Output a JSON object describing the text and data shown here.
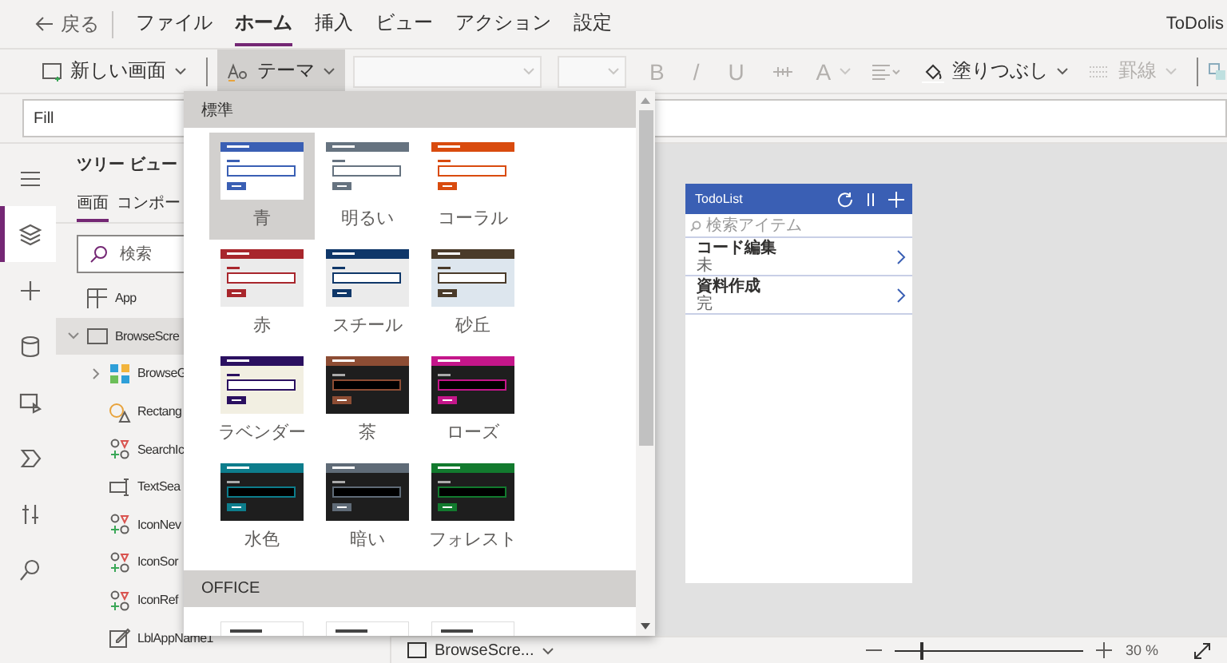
{
  "menu": {
    "back": "戻る",
    "tabs": [
      {
        "label": "ファイル",
        "selected": false
      },
      {
        "label": "ホーム",
        "selected": true
      },
      {
        "label": "挿入",
        "selected": false
      },
      {
        "label": "ビュー",
        "selected": false
      },
      {
        "label": "アクション",
        "selected": false
      },
      {
        "label": "設定",
        "selected": false
      }
    ],
    "app_name": "ToDolis"
  },
  "toolbar": {
    "new_screen": "新しい画面",
    "theme": {
      "label": "テーマ",
      "expanded": true
    },
    "format": [
      {
        "label": "B",
        "disabled": true
      },
      {
        "label": "/",
        "disabled": true
      },
      {
        "label": "U",
        "disabled": true
      },
      {
        "label": "A",
        "disabled": true
      }
    ],
    "fill": {
      "label": "塗りつぶし",
      "disabled": false
    },
    "border": {
      "label": "罫線",
      "disabled": true
    }
  },
  "formula": {
    "property": "Fill"
  },
  "rail": [
    {
      "kind": "menu",
      "selected": false
    },
    {
      "kind": "layers",
      "selected": true
    },
    {
      "kind": "insert",
      "selected": false
    },
    {
      "kind": "data",
      "selected": false
    },
    {
      "kind": "media",
      "selected": false
    },
    {
      "kind": "power",
      "selected": false
    },
    {
      "kind": "tools",
      "selected": false
    },
    {
      "kind": "search",
      "selected": false
    }
  ],
  "tree": {
    "title": "ツリー ビュー",
    "tabs": [
      {
        "label": "画面",
        "selected": true
      },
      {
        "label": "コンポー",
        "selected": false
      }
    ],
    "search": {
      "placeholder": "検索"
    },
    "items": [
      {
        "label": "App",
        "kind": "app",
        "selected": false
      },
      {
        "label": "BrowseScre",
        "kind": "screen",
        "selected": true,
        "expanded": true,
        "children": [
          {
            "label": "BrowseG",
            "kind": "gallery",
            "expanded": false,
            "selected": false
          },
          {
            "label": "Rectang",
            "kind": "shape",
            "selected": false
          },
          {
            "label": "SearchIc",
            "kind": "icon",
            "selected": false
          },
          {
            "label": "TextSea",
            "kind": "input",
            "selected": false
          },
          {
            "label": "IconNev",
            "kind": "icon",
            "selected": false
          },
          {
            "label": "IconSor",
            "kind": "icon",
            "selected": false
          },
          {
            "label": "IconRef",
            "kind": "icon",
            "selected": false
          },
          {
            "label": "LblAppName1",
            "kind": "label",
            "selected": false
          }
        ]
      }
    ]
  },
  "theme_menu": {
    "sections": [
      {
        "title": "標準",
        "themes": [
          {
            "label": "青",
            "color": "#3a5fb4",
            "kind": "light",
            "selected": true
          },
          {
            "label": "明るい",
            "color": "#667380",
            "kind": "light",
            "selected": false
          },
          {
            "label": "コーラル",
            "color": "#d94b0e",
            "kind": "light",
            "selected": false
          },
          {
            "label": "赤",
            "color": "#a8262c",
            "kind": "grey",
            "selected": false
          },
          {
            "label": "スチール",
            "color": "#0f3769",
            "kind": "grey",
            "selected": false
          },
          {
            "label": "砂丘",
            "color": "#4a3b2a",
            "kind": "blue",
            "selected": false
          },
          {
            "label": "ラベンダー",
            "color": "#2b1060",
            "kind": "cream",
            "selected": false
          },
          {
            "label": "茶",
            "color": "#8d4d34",
            "kind": "dark",
            "selected": false
          },
          {
            "label": "ローズ",
            "color": "#c4168a",
            "kind": "dark",
            "selected": false
          },
          {
            "label": "水色",
            "color": "#0d7d8c",
            "kind": "dark",
            "selected": false
          },
          {
            "label": "暗い",
            "color": "#5f6b77",
            "kind": "dark",
            "selected": false
          },
          {
            "label": "フォレスト",
            "color": "#127a2e",
            "kind": "dark",
            "selected": false
          }
        ]
      },
      {
        "title": "OFFICE",
        "themes": [
          {
            "kind": "office",
            "selected": false
          },
          {
            "kind": "office",
            "selected": false
          },
          {
            "kind": "office",
            "selected": false
          }
        ]
      }
    ]
  },
  "preview": {
    "title": "TodoList",
    "search": {
      "placeholder": "検索アイテム"
    },
    "items": [
      {
        "title": "コード編集",
        "subtitle": "未"
      },
      {
        "title": "資料作成",
        "subtitle": "完"
      }
    ]
  },
  "status_bar": {
    "screen": "BrowseScre...",
    "zoom": {
      "level": 0.14,
      "reading": "30 %"
    }
  }
}
